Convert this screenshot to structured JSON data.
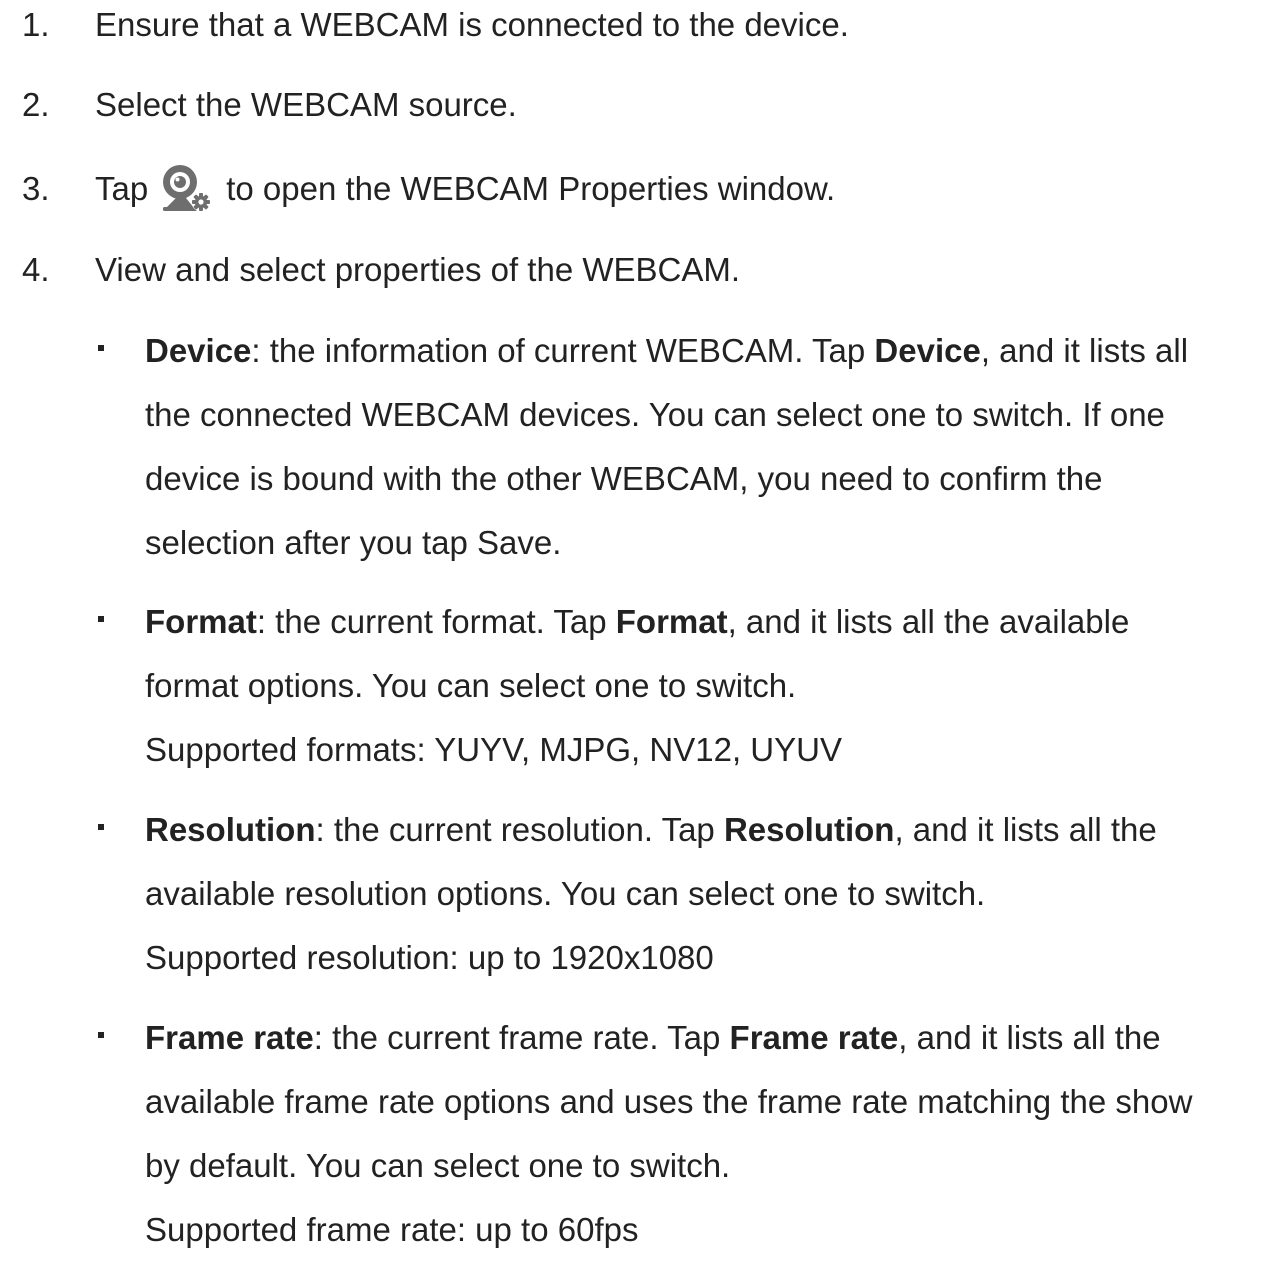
{
  "steps": [
    {
      "num": "1.",
      "text": "Ensure that a WEBCAM is connected to the device."
    },
    {
      "num": "2.",
      "text": "Select the WEBCAM source."
    },
    {
      "num": "3.",
      "text_before": "Tap",
      "icon": "webcam-settings-icon",
      "text_after": "to open the WEBCAM Properties window."
    },
    {
      "num": "4.",
      "text": "View and select properties of the WEBCAM."
    }
  ],
  "properties": {
    "device": {
      "term": "Device",
      "l1_a": ": the information of current WEBCAM. Tap ",
      "l1_b": "Device",
      "l1_c": ", and it lists all",
      "l2": "the connected WEBCAM devices. You can select one to switch. If one",
      "l3": "device is bound with the other WEBCAM, you need to confirm the",
      "l4": "selection after you tap Save."
    },
    "format": {
      "term": "Format",
      "l1_a": ": the current format. Tap ",
      "l1_b": "Format",
      "l1_c": ", and it lists all the available",
      "l2": "format options. You can select one to switch.",
      "l3": "Supported formats: YUYV, MJPG, NV12, UYUV"
    },
    "resolution": {
      "term": "Resolution",
      "l1_a": ": the current resolution. Tap ",
      "l1_b": "Resolution",
      "l1_c": ", and it lists all the",
      "l2": "available resolution options. You can select one to switch.",
      "l3": "Supported resolution: up to 1920x1080"
    },
    "frame_rate": {
      "term": "Frame rate",
      "l1_a": ": the current frame rate. Tap ",
      "l1_b": "Frame rate",
      "l1_c": ", and it lists all the",
      "l2": "available frame rate options and uses the frame rate matching the show",
      "l3": "by default. You can select one to switch.",
      "l4": "Supported frame rate: up to 60fps"
    }
  },
  "colors": {
    "text": "#222222",
    "icon": "#6e6e6e"
  }
}
